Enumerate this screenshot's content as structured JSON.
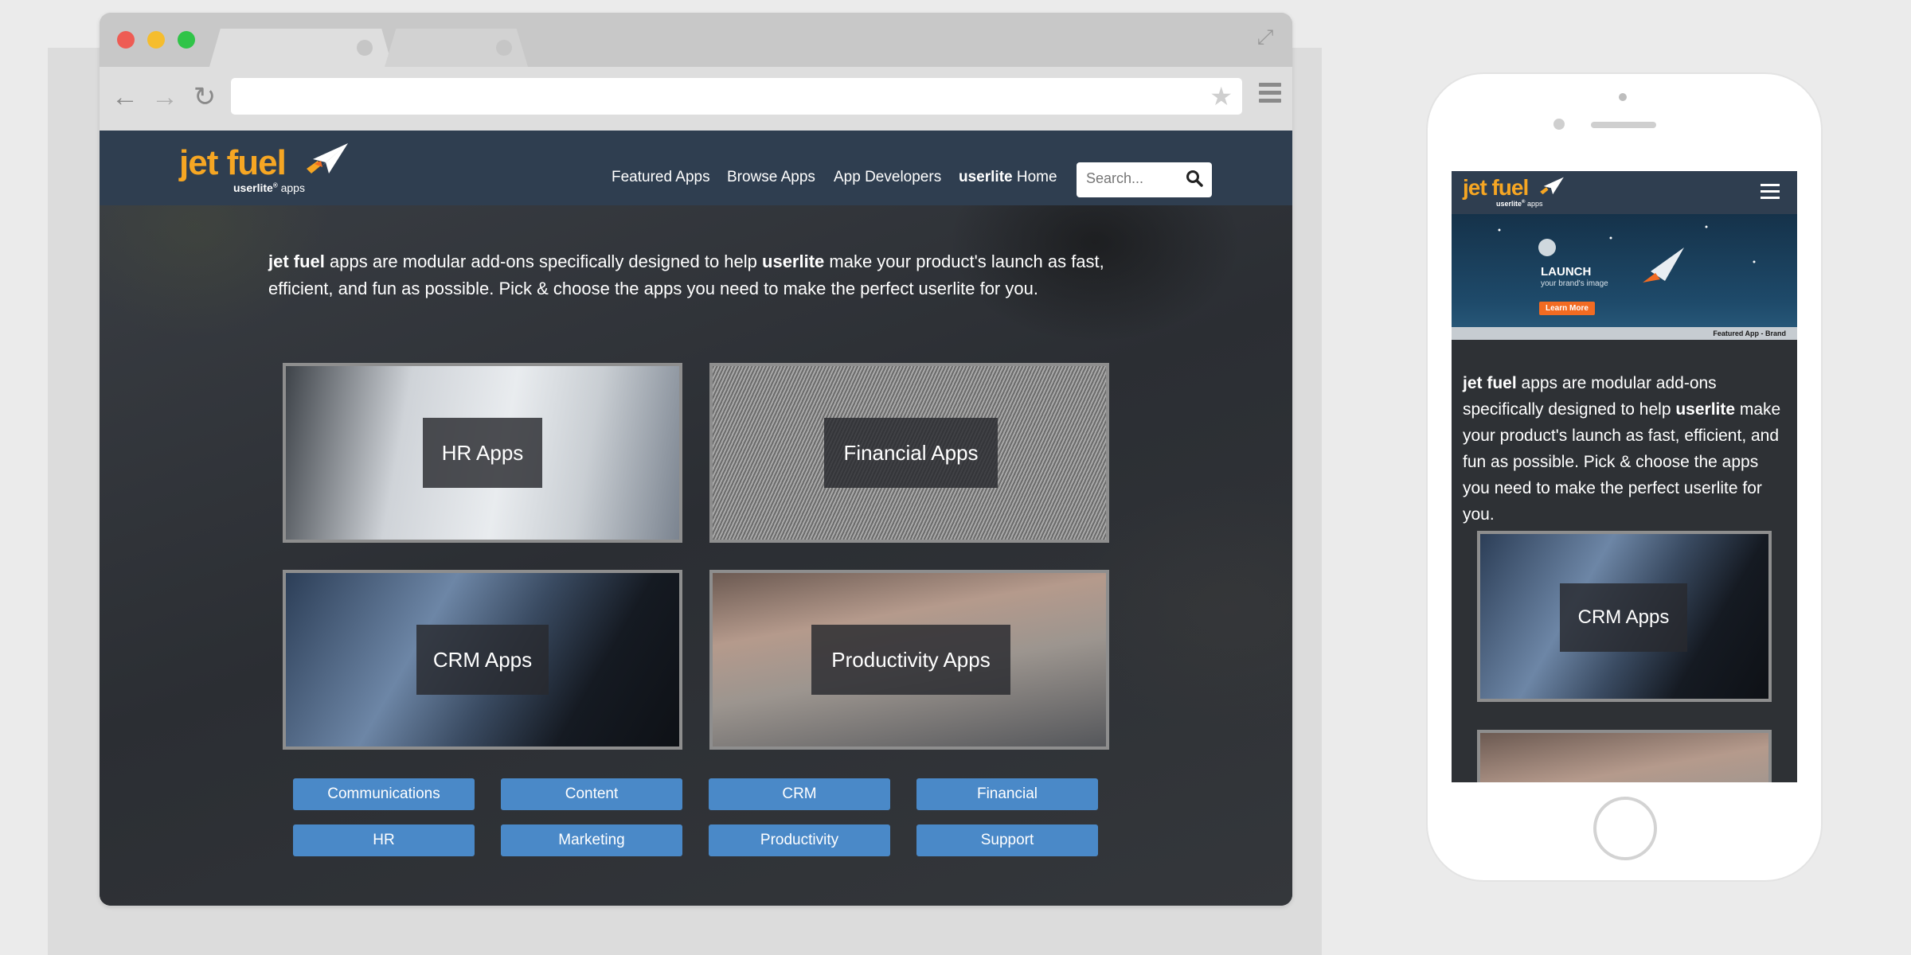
{
  "site": {
    "logo_text": "jet fuel",
    "logo_brand": "userlite",
    "logo_reg": "®",
    "logo_suffix": "apps",
    "nav": [
      "Featured Apps",
      "Browse Apps",
      "App Developers"
    ],
    "nav_home_bold": "userlite",
    "nav_home_rest": " Home",
    "search_placeholder": "Search...",
    "intro_bold_1": "jet fuel",
    "intro_part_1": " apps are modular add-ons specifically designed to help ",
    "intro_bold_2": "userlite",
    "intro_part_2": " make your product's launch as fast, efficient, and fun as possible. Pick & choose the apps you need to make the perfect userlite for you.",
    "cards": [
      "HR Apps",
      "Financial Apps",
      "CRM Apps",
      "Productivity Apps"
    ],
    "category_buttons": [
      "Communications",
      "Content",
      "CRM",
      "Financial",
      "HR",
      "Marketing",
      "Productivity",
      "Support"
    ]
  },
  "mobile": {
    "banner_title": "LAUNCH",
    "banner_subtitle": "your brand's image",
    "banner_button": "Learn More",
    "banner_caption": "Featured App - Brand",
    "card": "CRM Apps"
  },
  "colors": {
    "nav_bg": "#2f3e50",
    "logo_orange": "#f6a623",
    "button_blue": "#4a89c8",
    "banner_cta": "#f26b22"
  },
  "icons": [
    "back-arrow-icon",
    "forward-arrow-icon",
    "reload-icon",
    "star-icon",
    "menu-icon",
    "expand-icon",
    "search-icon",
    "paper-plane-icon",
    "hamburger-icon"
  ]
}
